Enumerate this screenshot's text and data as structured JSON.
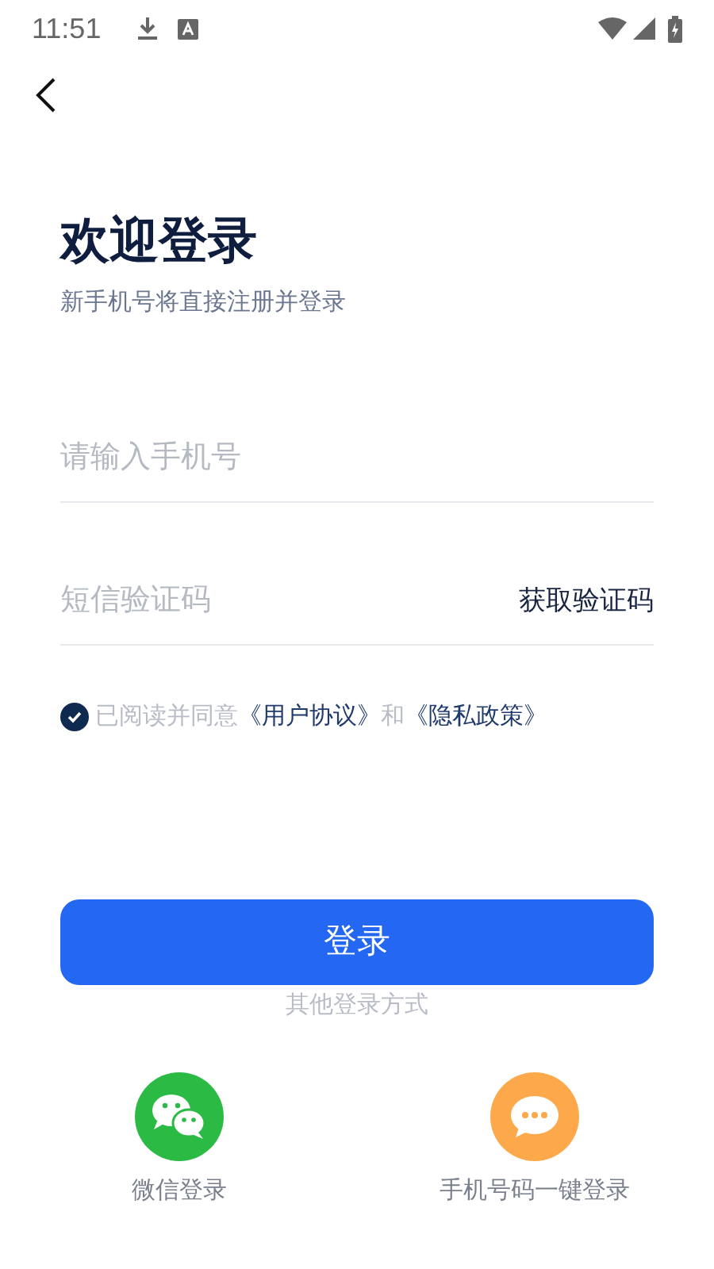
{
  "status_bar": {
    "time": "11:51"
  },
  "title": "欢迎登录",
  "subtitle": "新手机号将直接注册并登录",
  "phone_field": {
    "placeholder": "请输入手机号"
  },
  "code_field": {
    "placeholder": "短信验证码",
    "action": "获取验证码"
  },
  "agreement": {
    "checked": true,
    "text": "已阅读并同意",
    "link_1": "《用户协议》",
    "joiner": "和",
    "link_2": "《隐私政策》"
  },
  "login_button": "登录",
  "other_methods": {
    "label": "其他登录方式",
    "items": [
      {
        "kind": "wechat",
        "label": "微信登录"
      },
      {
        "kind": "phone",
        "label": "手机号码一键登录"
      }
    ]
  }
}
